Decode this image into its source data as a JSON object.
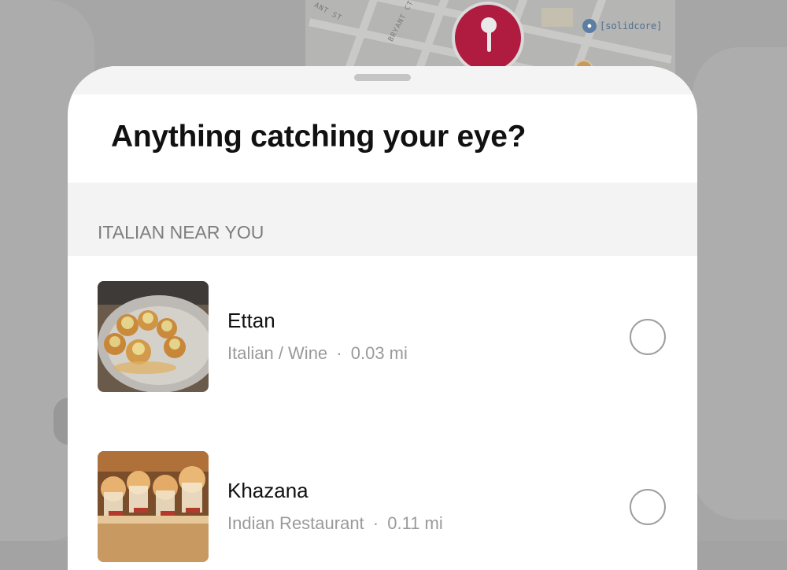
{
  "map": {
    "street_labels": [
      "ANT ST",
      "BRYANT CT"
    ],
    "poi_name": "[solidcore]",
    "poi_icon": "dumbbell-icon",
    "pin_icon": "location-pin-icon"
  },
  "sheet": {
    "title": "Anything catching your eye?",
    "section_label": "ITALIAN NEAR YOU",
    "places": [
      {
        "name": "Ettan",
        "category": "Italian / Wine",
        "distance": "0.03 mi",
        "selected": false
      },
      {
        "name": "Khazana",
        "category": "Indian Restaurant",
        "distance": "0.11 mi",
        "selected": false
      }
    ],
    "separator": "·"
  },
  "colors": {
    "pin": "#b01b40",
    "poi": "#5b7ea4",
    "backdrop": "#a6a6a6"
  }
}
